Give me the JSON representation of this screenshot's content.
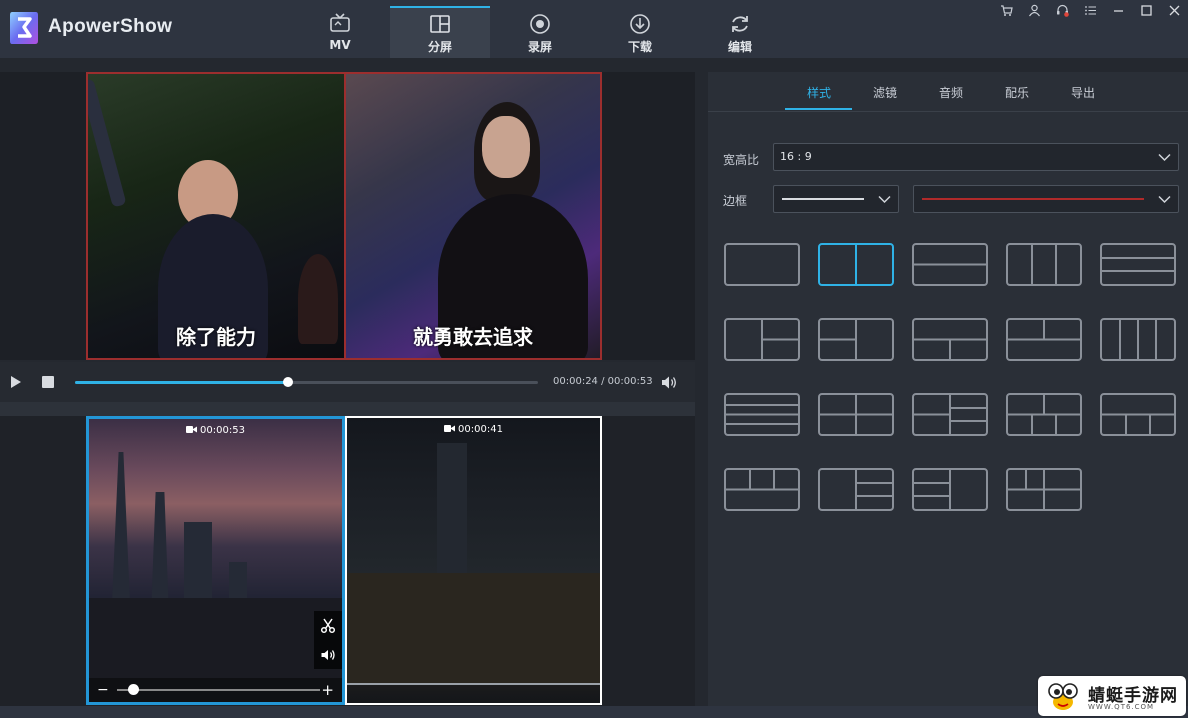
{
  "app": {
    "name": "ApowerShow"
  },
  "nav": {
    "tabs": [
      {
        "label": "MV",
        "icon": "tv-icon",
        "active": false
      },
      {
        "label": "分屏",
        "icon": "split-screen-icon",
        "active": true
      },
      {
        "label": "录屏",
        "icon": "record-icon",
        "active": false
      },
      {
        "label": "下载",
        "icon": "download-icon",
        "active": false
      },
      {
        "label": "编辑",
        "icon": "refresh-icon",
        "active": false
      }
    ]
  },
  "window_controls": [
    "cart-icon",
    "user-icon",
    "support-icon",
    "menu-icon",
    "minimize-icon",
    "maximize-icon",
    "close-icon"
  ],
  "preview": {
    "subtitle_left": "除了能力",
    "subtitle_right": "就勇敢去追求",
    "border_color": "#9c2e2e",
    "timecode": "00:00:24 / 00:00:53",
    "progress": 0.46
  },
  "clips": [
    {
      "duration": "00:00:53",
      "selected": true
    },
    {
      "duration": "00:00:41",
      "selected": false
    }
  ],
  "clip_zoom": {
    "minus": "−",
    "plus": "+",
    "value": 0.08
  },
  "right_panel": {
    "tabs": [
      "样式",
      "滤镜",
      "音频",
      "配乐",
      "导出"
    ],
    "active_tab": "样式",
    "aspect_label": "宽高比",
    "aspect_value": "16 : 9",
    "border_label": "边框",
    "border_line_color": "#d8dbe0",
    "border_color": "#b02a2a",
    "layout_count": 19,
    "selected_layout": 1
  },
  "watermark": {
    "text": "蜻蜓手游网",
    "sub": "WWW.QT6.COM"
  },
  "colors": {
    "accent": "#2fb2e6",
    "background": "#24282f",
    "header": "#2e3440"
  }
}
